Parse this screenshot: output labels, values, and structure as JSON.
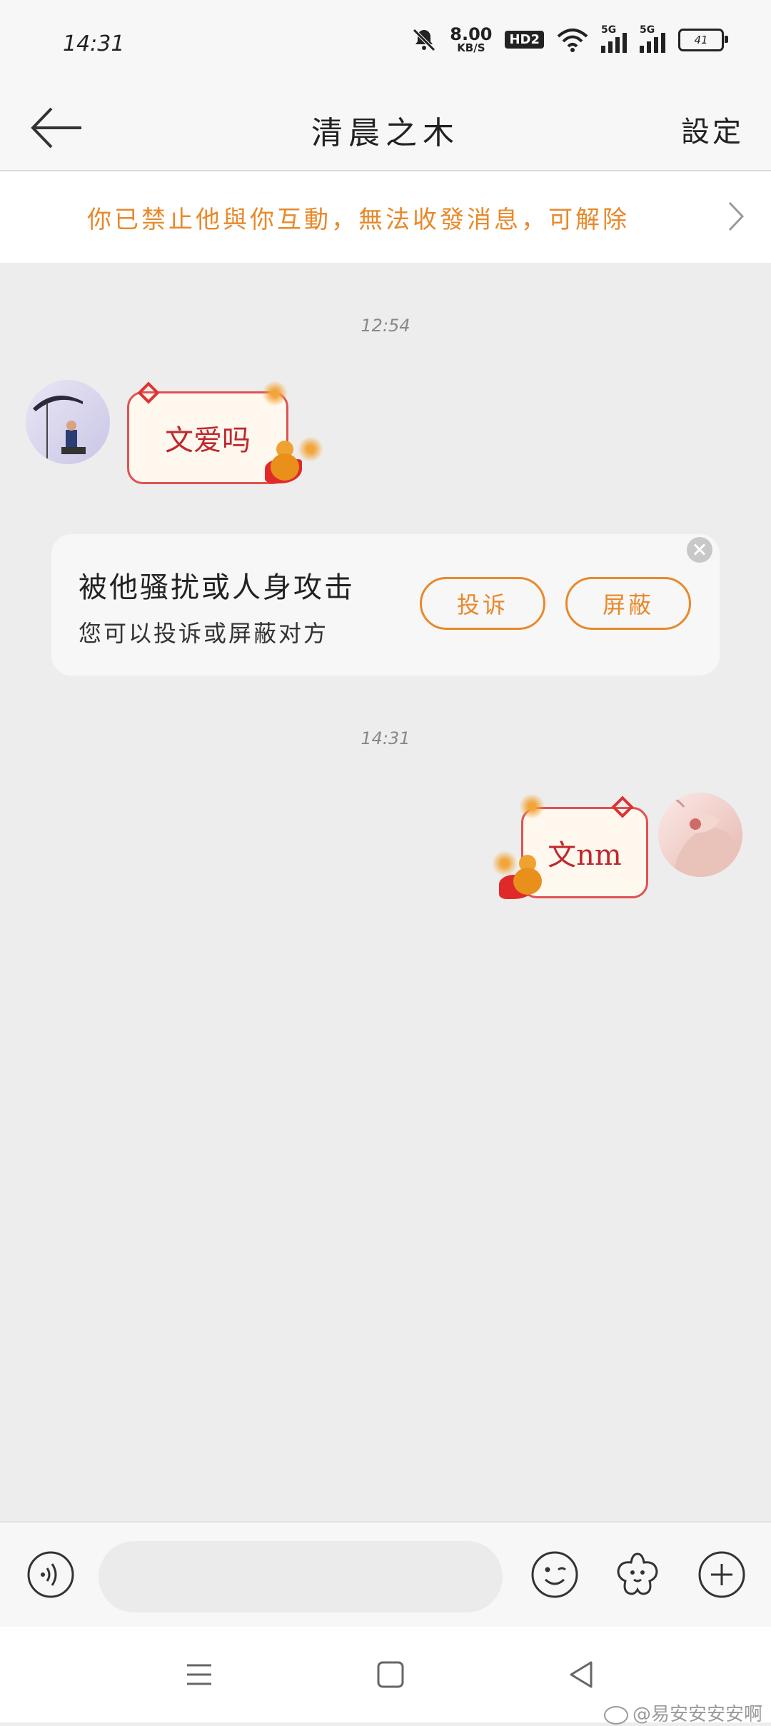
{
  "status_bar": {
    "time": "14:31",
    "net_speed_value": "8.00",
    "net_speed_unit": "KB/S",
    "hd_badge": "HD2",
    "sim1_label": "5G",
    "sim2_label": "5G",
    "battery_level": "41"
  },
  "header": {
    "title": "清晨之木",
    "settings_label": "設定"
  },
  "notice": {
    "text": "你已禁止他與你互動，無法收發消息，可解除"
  },
  "messages": [
    {
      "timestamp": "12:54",
      "sender": "other",
      "text": "文爱吗"
    },
    {
      "timestamp": "14:31",
      "sender": "self",
      "text": "文nm"
    }
  ],
  "report_card": {
    "title": "被他骚扰或人身攻击",
    "subtitle": "您可以投诉或屏蔽对方",
    "complain_label": "投诉",
    "block_label": "屏蔽"
  },
  "input": {
    "placeholder": ""
  },
  "watermark": {
    "text": "@易安安安安啊"
  },
  "colors": {
    "accent": "#e8892b",
    "bubble_border": "#e05252",
    "bubble_text": "#c0282d",
    "background": "#ededed"
  }
}
